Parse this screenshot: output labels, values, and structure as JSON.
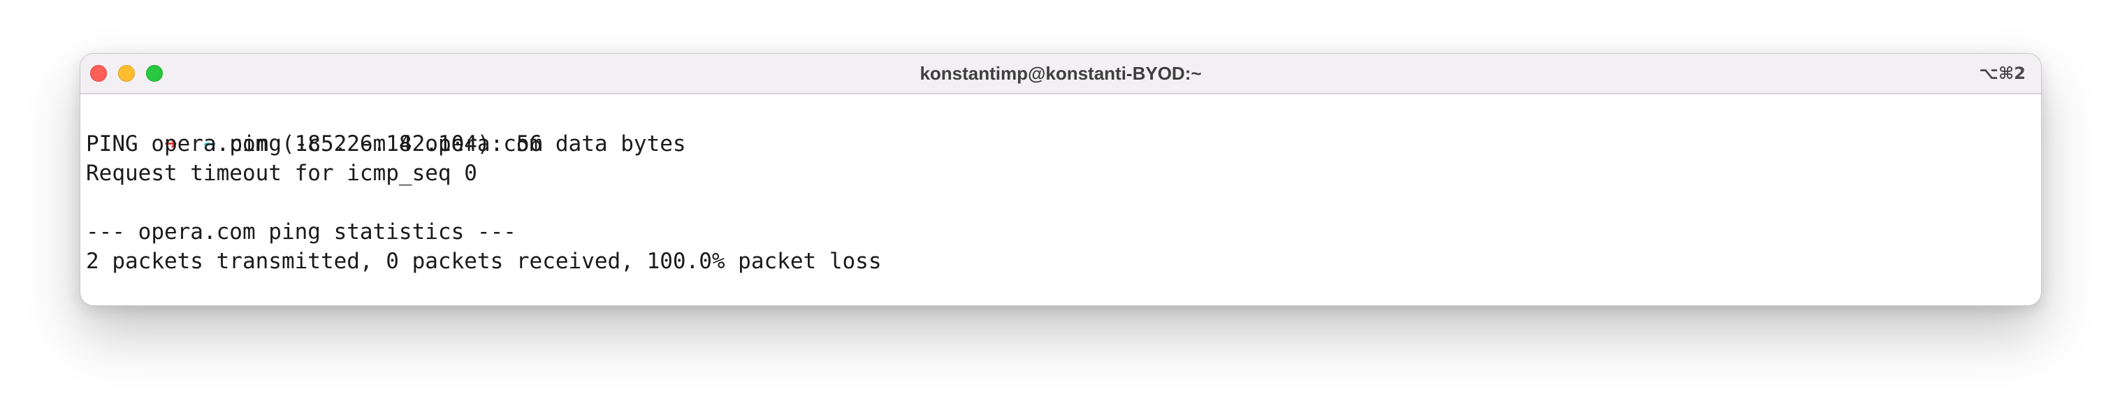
{
  "window": {
    "title": "konstantimp@konstanti-BYOD:~",
    "shortcut": "⌥⌘2"
  },
  "colors": {
    "prompt_arrow": "#e53935",
    "prompt_dir": "#2bbcc8"
  },
  "terminal": {
    "prompt_arrow": "➜",
    "prompt_dir": "~",
    "lines": [
      {
        "type": "prompt",
        "command": "ping -c 2 -m 4 opera.com"
      },
      {
        "type": "output",
        "text": "PING opera.com (185.26.182.104): 56 data bytes"
      },
      {
        "type": "output",
        "text": "Request timeout for icmp_seq 0"
      },
      {
        "type": "output",
        "text": ""
      },
      {
        "type": "output",
        "text": "--- opera.com ping statistics ---"
      },
      {
        "type": "output",
        "text": "2 packets transmitted, 0 packets received, 100.0% packet loss"
      },
      {
        "type": "prompt",
        "command": ""
      }
    ]
  }
}
